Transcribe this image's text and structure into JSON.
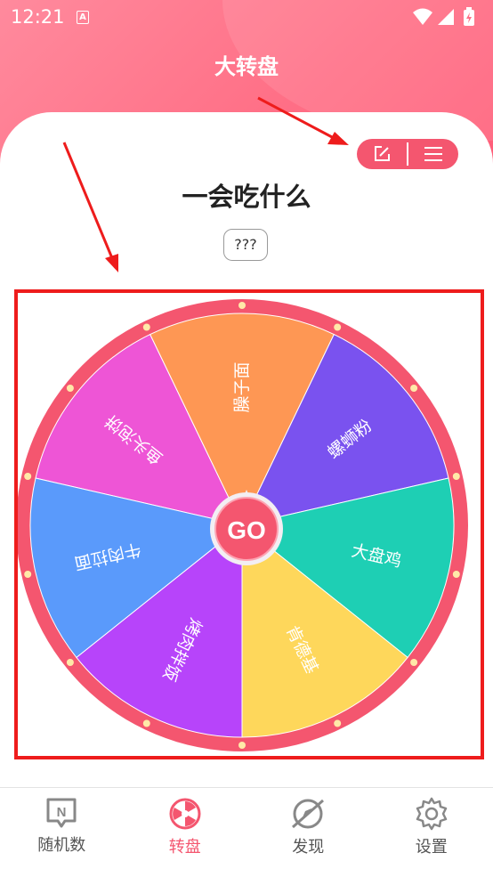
{
  "status_bar": {
    "time": "12:21",
    "notification_icon": "a-badge-icon",
    "icons": [
      "wifi-icon",
      "signal-icon",
      "battery-charging-icon"
    ]
  },
  "header": {
    "title": "大转盘"
  },
  "toolbar": {
    "edit_icon": "edit-icon",
    "menu_icon": "menu-icon"
  },
  "wheel": {
    "title": "一会吃什么",
    "result": "???",
    "go_label": "GO",
    "segments": [
      {
        "label": "鱼头泡饼",
        "color": "#ee55d6"
      },
      {
        "label": "臊子面",
        "color": "#fe9754"
      },
      {
        "label": "螺蛳粉",
        "color": "#7a52ef"
      },
      {
        "label": "大盘鸡",
        "color": "#1ecfb4"
      },
      {
        "label": "肯德基",
        "color": "#fed75b"
      },
      {
        "label": "烤肉拌饭",
        "color": "#b744fa"
      },
      {
        "label": "牛肉拉面",
        "color": "#5a9afb"
      }
    ]
  },
  "bottom_nav": [
    {
      "label": "随机数",
      "icon": "random-number-icon",
      "active": false
    },
    {
      "label": "转盘",
      "icon": "wheel-icon",
      "active": true
    },
    {
      "label": "发现",
      "icon": "discover-icon",
      "active": false
    },
    {
      "label": "设置",
      "icon": "gear-icon",
      "active": false
    }
  ],
  "colors": {
    "accent": "#f4566f",
    "annotation": "#ee1c1c",
    "rim": "#f4566f",
    "inactive": "#888888"
  }
}
